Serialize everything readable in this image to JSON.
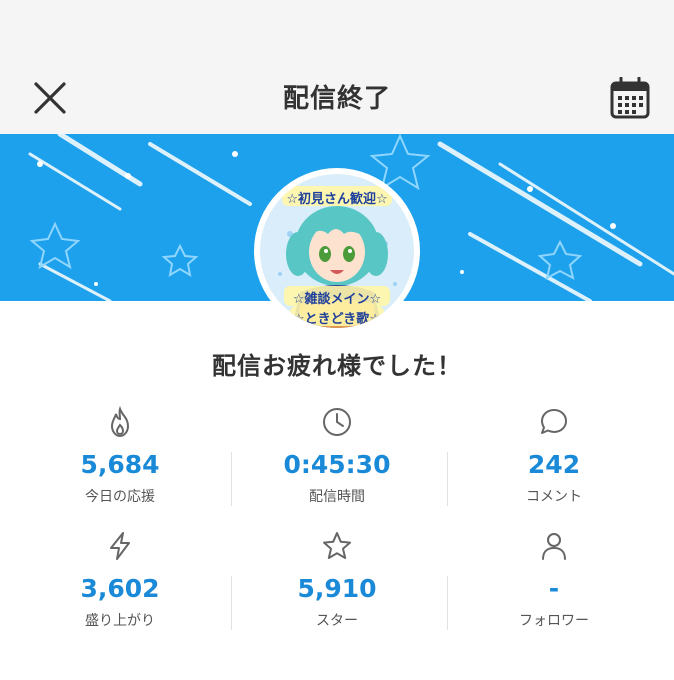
{
  "header": {
    "title": "配信終了",
    "close_icon": "close-icon",
    "calendar_icon": "calendar-icon"
  },
  "avatar": {
    "caption_top": "☆初見さん歓迎☆",
    "caption_mid": "☆雑談メイン☆",
    "caption_bottom": "☆ときどき歌☆"
  },
  "greeting": "配信お疲れ様でした！",
  "stats": [
    {
      "icon": "flame-icon",
      "value": "5,684",
      "label": "今日の応援"
    },
    {
      "icon": "clock-icon",
      "value": "0:45:30",
      "label": "配信時間"
    },
    {
      "icon": "comment-icon",
      "value": "242",
      "label": "コメント"
    },
    {
      "icon": "bolt-icon",
      "value": "3,602",
      "label": "盛り上がり"
    },
    {
      "icon": "star-icon",
      "value": "5,910",
      "label": "スター"
    },
    {
      "icon": "person-icon",
      "value": "-",
      "label": "フォロワー"
    }
  ],
  "colors": {
    "banner": "#1da1ec",
    "value": "#1a8ad8",
    "header_bg": "#f5f5f5"
  }
}
